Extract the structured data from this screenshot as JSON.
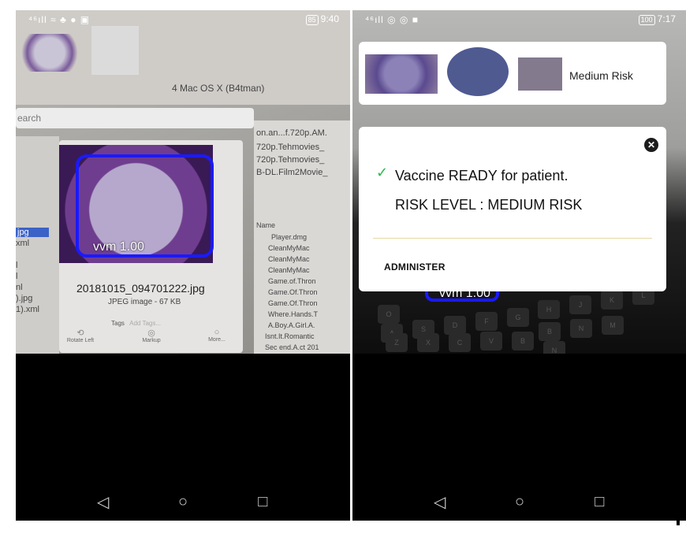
{
  "left_phone": {
    "status": {
      "left_icons": "⁴⁶ıll ≈ ♣ ● ▣",
      "battery": "85",
      "time": "9:40"
    },
    "background_text": {
      "os_title": "4 Mac OS X (B4tman)",
      "search_placeholder": "earch",
      "filenames_right": [
        "on.an...f.720p.AM.",
        "720p.Tehmovies_",
        "720p.Tehmovies_",
        "B-DL.Film2Movie_"
      ],
      "column_header": "Name",
      "file_list": [
        "Player.dmg",
        "CleanMyMac",
        "CleanMyMac",
        "CleanMyMac",
        "Game.of.Thron",
        "Game.Of.Thron",
        "Game.Of.Thron",
        "Where.Hands.T",
        "A.Boy.A.Girl.A.",
        "Isnt.It.Romantic",
        "Sec end.A.ct 201"
      ],
      "left_list": [
        "jpg",
        "xml",
        "l",
        "l",
        "nl",
        ").jpg",
        "1).xml"
      ]
    },
    "preview": {
      "file_name": "20181015_094701222.jpg",
      "file_type": "JPEG image - 67 KB",
      "tags_label": "Tags",
      "add_tags": "Add Tags...",
      "tools": [
        "Rotate Left",
        "Markup",
        "More..."
      ]
    },
    "detection_label": "vvm 1.00"
  },
  "right_phone": {
    "status": {
      "left_icons": "⁴⁶ıll ◎ ◎ ■",
      "battery": "100",
      "time": "7:17"
    },
    "result_card": {
      "risk_label": "Medium Risk"
    },
    "dialog": {
      "message": "Vaccine READY for patient.",
      "risk_level": "RISK LEVEL : MEDIUM RISK",
      "action_button": "ADMINISTER"
    },
    "detection_label": "vvm 1.00",
    "keyboard_keys": [
      "O",
      "H",
      "J",
      "K",
      "L",
      "A",
      "S",
      "D",
      "F",
      "G",
      "B",
      "N",
      "M",
      "Z",
      "X",
      "C",
      "V",
      "B",
      "N"
    ]
  },
  "navbar": {
    "back": "◁",
    "home": "○",
    "recents": "□"
  },
  "colors": {
    "detect_box": "#1a1aff",
    "check": "#2fb84f",
    "divider": "#e3d9a3"
  }
}
